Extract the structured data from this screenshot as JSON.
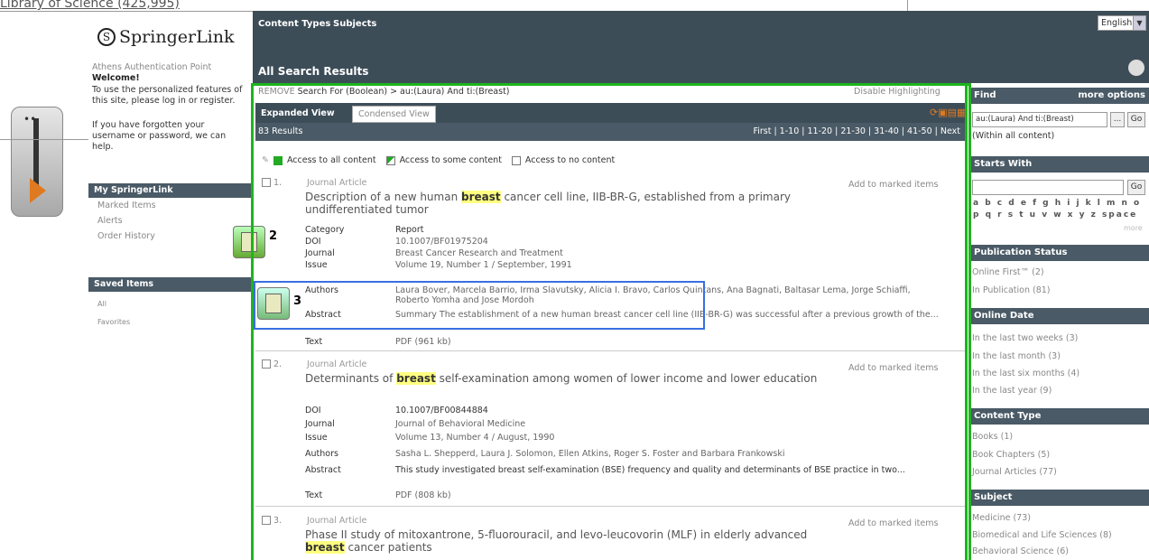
{
  "top_crumb": "Library of Science (425,995)",
  "brand": "SpringerLink",
  "brand_mark": "S",
  "nav": {
    "content_types": "Content Types",
    "subjects": "Subjects",
    "language": "English",
    "page_title": "All Search Results"
  },
  "sidebar": {
    "athens": "Athens Authentication Point",
    "welcome": "Welcome!",
    "welcome_text": "To use the personalized features of this site, please log in or register.",
    "forgot_text": "If you have forgotten your username or password, we can help.",
    "my_springer": "My SpringerLink",
    "my_items": [
      "Marked Items",
      "Alerts",
      "Order History"
    ],
    "saved_items": "Saved Items",
    "saved_list": [
      "All",
      "Favorites"
    ]
  },
  "search": {
    "remove": "REMOVE",
    "query": "Search For (Boolean) > au:(Laura) And ti:(Breast)",
    "disable": "Disable Highlighting",
    "tab_expanded": "Expanded View",
    "tab_condensed": "Condensed View",
    "results_count": "83 Results",
    "pager": "First | 1-10 | 11-20 | 21-30 | 31-40 | 41-50 | Next",
    "legend": [
      "Access to all content",
      "Access to some content",
      "Access to no content"
    ]
  },
  "results": [
    {
      "num": "1.",
      "kind": "Journal Article",
      "title_pre": "Description of a new human ",
      "title_hl": "breast",
      "title_post": " cancer cell line, IIB-BR-G, established from a primary undifferentiated tumor",
      "add": "Add to marked items",
      "rows": [
        [
          "Category",
          "Report"
        ],
        [
          "DOI",
          "10.1007/BF01975204"
        ],
        [
          "Journal",
          "Breast Cancer Research and Treatment"
        ],
        [
          "Issue",
          "Volume 19, Number 1 / September, 1991"
        ],
        [
          "Authors",
          "Laura Bover, Marcela Barrio, Irma Slavutsky, Alicia I. Bravo, Carlos Quintans, Ana Bagnati, Baltasar Lema, Jorge Schiaffi, Roberto Yomha and Jose Mordoh"
        ],
        [
          "Abstract",
          "Summary The establishment of a new human breast cancer cell line (IIB-BR-G) was successful after a previous growth of the..."
        ],
        [
          "Text",
          "PDF (961 kb)"
        ]
      ]
    },
    {
      "num": "2.",
      "kind": "Journal Article",
      "title_pre": "Determinants of ",
      "title_hl": "breast",
      "title_post": " self-examination among women of lower income and lower education",
      "add": "Add to marked items",
      "rows": [
        [
          "DOI",
          "10.1007/BF00844884"
        ],
        [
          "Journal",
          "Journal of Behavioral Medicine"
        ],
        [
          "Issue",
          "Volume 13, Number 4 / August, 1990"
        ],
        [
          "Authors",
          "Sasha L. Shepperd, Laura J. Solomon, Ellen Atkins, Roger S. Foster and Barbara Frankowski"
        ],
        [
          "Abstract",
          "This study investigated breast self-examination (BSE) frequency and quality and determinants of BSE practice in two..."
        ],
        [
          "Text",
          "PDF (808 kb)"
        ]
      ]
    },
    {
      "num": "3.",
      "kind": "Journal Article",
      "title_pre": "Phase II study of mitoxantrone, 5-fluorouracil, and levo-leucovorin (MLF) in elderly advanced ",
      "title_hl": "breast",
      "title_post": " cancer patients",
      "add": "Add to marked items",
      "rows": []
    }
  ],
  "badges": {
    "two": "2",
    "three": "3"
  },
  "right": {
    "find": "Find",
    "more_options": "more options",
    "find_value": "au:(Laura) And ti:(Breast)",
    "go": "Go",
    "more_btn": "...",
    "within": "(Within all content)",
    "starts_with": "Starts With",
    "alpha1": "a b c d e f g h i j k l m n o",
    "alpha2": "p q r s t u v w x y z space",
    "more": "more",
    "pub_status": "Publication Status",
    "pub_items": [
      "Online First™ (2)",
      "In Publication (81)"
    ],
    "online_date": "Online Date",
    "date_items": [
      "In the last two weeks (3)",
      "In the last month (3)",
      "In the last six months (4)",
      "In the last year (9)"
    ],
    "content_type": "Content Type",
    "ct_items": [
      "Books (1)",
      "Book Chapters (5)",
      "Journal Articles (77)"
    ],
    "subject": "Subject",
    "subj_items": [
      "Medicine (73)",
      "Biomedical and Life Sciences (8)",
      "Behavioral Science (6)"
    ]
  },
  "colors": {
    "header": "#3d4d58",
    "green_box": "#1db41d",
    "blue_box": "#3a6fe0",
    "highlight": "#ffff80"
  }
}
